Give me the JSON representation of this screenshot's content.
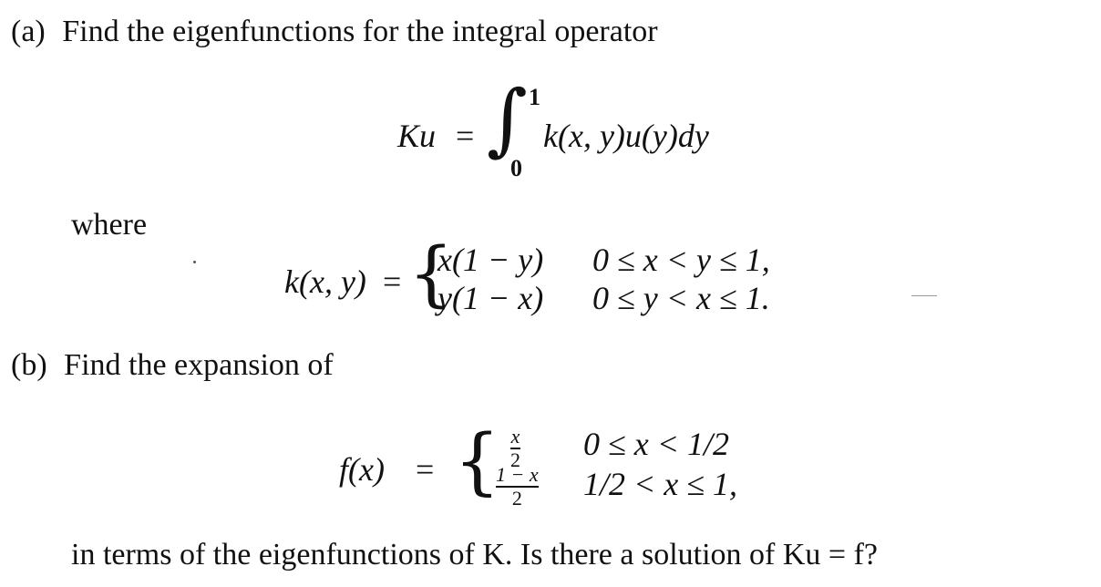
{
  "part_a": {
    "label": "(a)",
    "prompt": "Find the eigenfunctions for the integral operator",
    "operator": {
      "lhs": "Ku",
      "equals": "=",
      "lower_limit": "0",
      "upper_limit": "1",
      "integrand": "k(x, y)u(y)dy"
    },
    "where_label": "where",
    "kernel": {
      "lhs": "k(x, y)",
      "equals": "=",
      "cases": [
        {
          "expr": "x(1 − y)",
          "condition": "0 ≤ x < y ≤ 1,"
        },
        {
          "expr": "y(1 − x)",
          "condition": "0 ≤ y < x ≤ 1."
        }
      ]
    }
  },
  "part_b": {
    "label": "(b)",
    "prompt": "Find the expansion of",
    "function": {
      "lhs": "f(x)",
      "equals": "=",
      "cases": [
        {
          "numerator": "x",
          "denominator": "2",
          "condition": "0 ≤ x < 1/2"
        },
        {
          "numerator": "1 − x",
          "denominator": "2",
          "condition": "1/2 < x ≤ 1,"
        }
      ]
    },
    "closing": "in terms of the eigenfunctions of K. Is there a solution of Ku = f?"
  }
}
